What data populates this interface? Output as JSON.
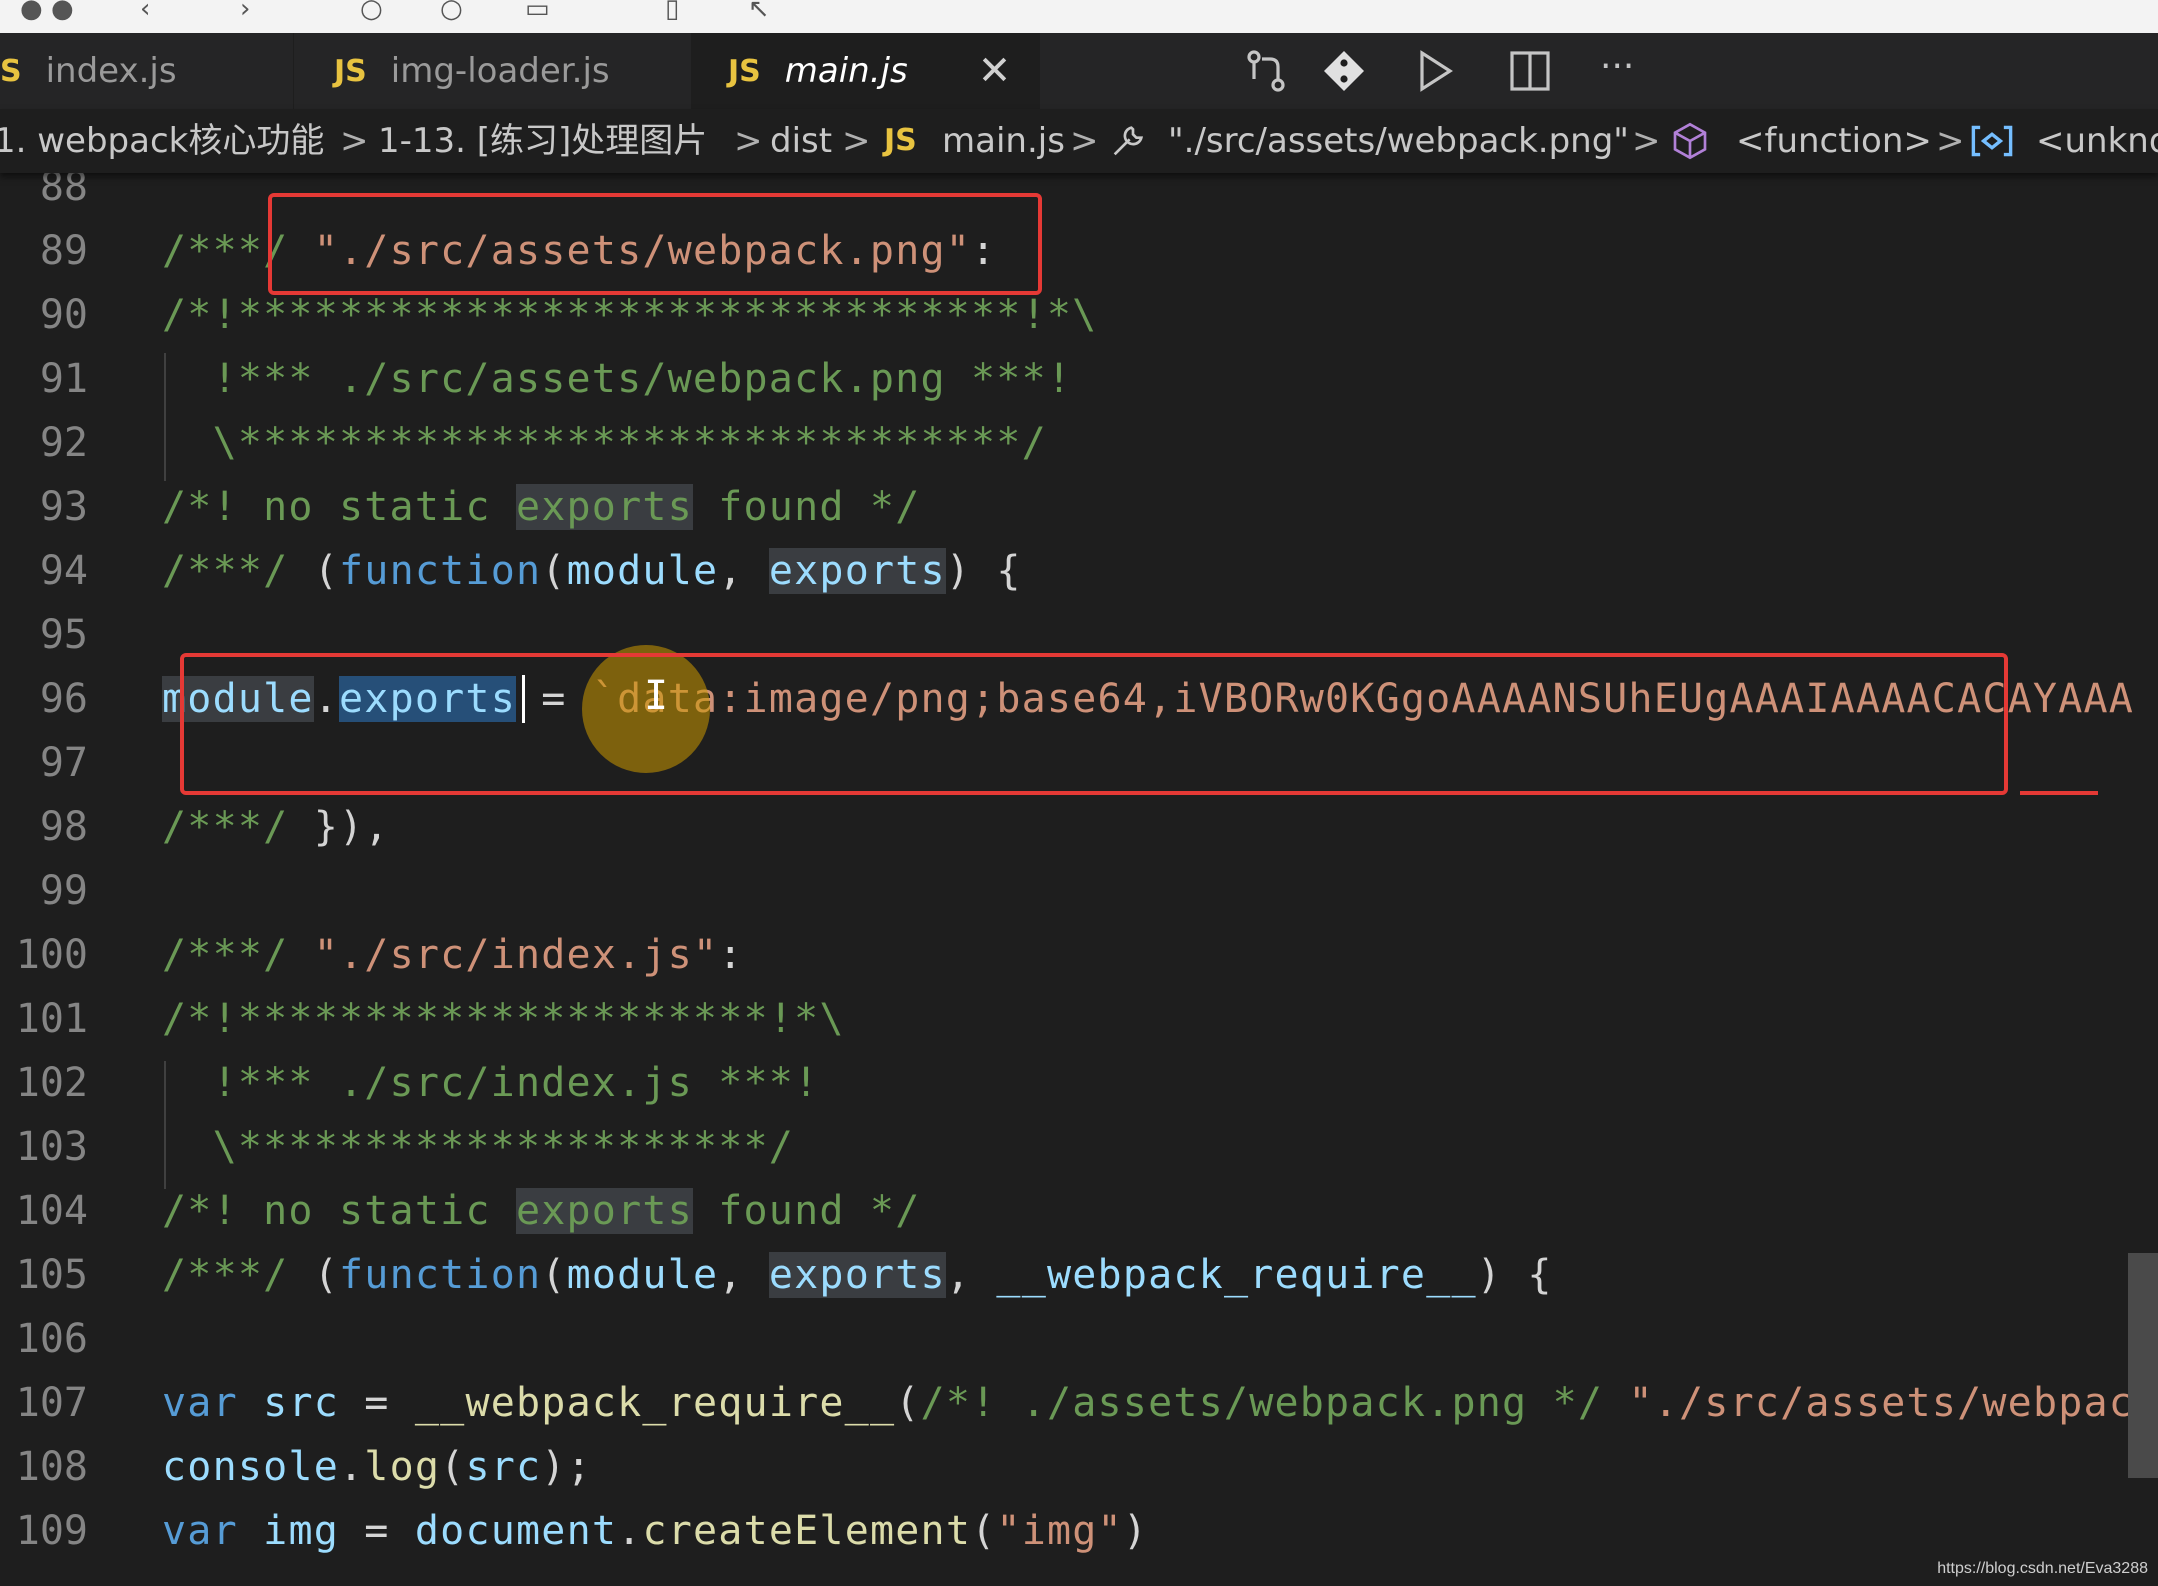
{
  "tabs": [
    {
      "icon": "S",
      "label": "index.js",
      "active": false
    },
    {
      "icon": "JS",
      "label": "img-loader.js",
      "active": false
    },
    {
      "icon": "JS",
      "label": "main.js",
      "active": true
    }
  ],
  "tab_close_glyph": "✕",
  "breadcrumb": {
    "items": [
      "1. webpack核心功能",
      "1-13. [练习]处理图片",
      "dist",
      "main.js",
      "\"./src/assets/webpack.png\"",
      "<function>",
      "<unkno"
    ],
    "js_badge": "JS",
    "separator": ">"
  },
  "editor": {
    "line_numbers": [
      "88",
      "89",
      "90",
      "91",
      "92",
      "93",
      "94",
      "95",
      "96",
      "97",
      "98",
      "99",
      "100",
      "101",
      "102",
      "103",
      "104",
      "105",
      "106",
      "107",
      "108",
      "109"
    ]
  },
  "watermark": "https://blog.csdn.net/Eva3288",
  "colors": {
    "annotation_red": "#e53935",
    "accent_js": "#e8c340"
  },
  "icons": [
    "source-control-icon",
    "git-icon",
    "run-icon",
    "split-editor-icon",
    "more-icon",
    "wrench-icon",
    "cube-icon",
    "variable-icon"
  ]
}
